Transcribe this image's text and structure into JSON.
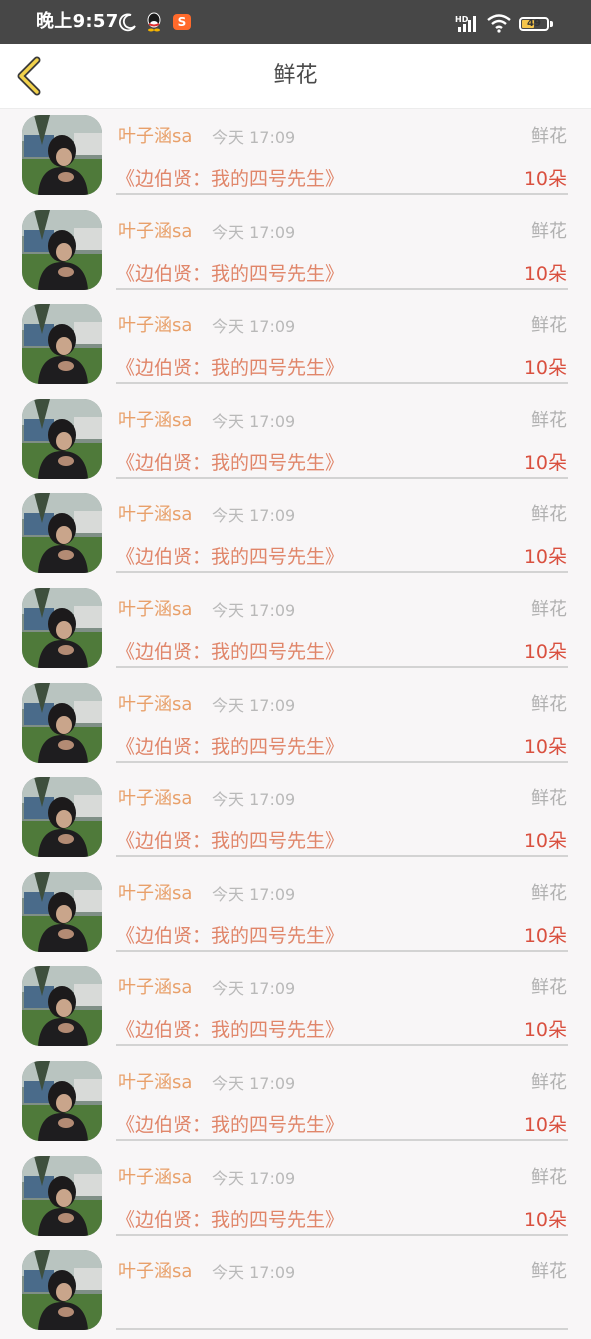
{
  "status_bar": {
    "time": "晚上9:57",
    "icons": [
      "moon-icon",
      "qq-icon",
      "sogou-icon",
      "hd-signal-icon",
      "wifi-icon",
      "battery-icon"
    ],
    "signal_label": "HD",
    "sogou_label": "S",
    "battery_percent": 49,
    "battery_text": "49"
  },
  "header": {
    "title": "鲜花",
    "back_icon": "chevron-left-icon",
    "accent_color": "#f2d24b"
  },
  "colors": {
    "user_name": "#e8a06a",
    "work_title": "#e0866a",
    "quantity": "#d9503f",
    "meta": "#b9b9b9"
  },
  "items": [
    {
      "user": "叶子涵sa",
      "time": "今天 17:09",
      "type": "鲜花",
      "work": "《边伯贤：我的四号先生》",
      "quantity": "10朵"
    },
    {
      "user": "叶子涵sa",
      "time": "今天 17:09",
      "type": "鲜花",
      "work": "《边伯贤：我的四号先生》",
      "quantity": "10朵"
    },
    {
      "user": "叶子涵sa",
      "time": "今天 17:09",
      "type": "鲜花",
      "work": "《边伯贤：我的四号先生》",
      "quantity": "10朵"
    },
    {
      "user": "叶子涵sa",
      "time": "今天 17:09",
      "type": "鲜花",
      "work": "《边伯贤：我的四号先生》",
      "quantity": "10朵"
    },
    {
      "user": "叶子涵sa",
      "time": "今天 17:09",
      "type": "鲜花",
      "work": "《边伯贤：我的四号先生》",
      "quantity": "10朵"
    },
    {
      "user": "叶子涵sa",
      "time": "今天 17:09",
      "type": "鲜花",
      "work": "《边伯贤：我的四号先生》",
      "quantity": "10朵"
    },
    {
      "user": "叶子涵sa",
      "time": "今天 17:09",
      "type": "鲜花",
      "work": "《边伯贤：我的四号先生》",
      "quantity": "10朵"
    },
    {
      "user": "叶子涵sa",
      "time": "今天 17:09",
      "type": "鲜花",
      "work": "《边伯贤：我的四号先生》",
      "quantity": "10朵"
    },
    {
      "user": "叶子涵sa",
      "time": "今天 17:09",
      "type": "鲜花",
      "work": "《边伯贤：我的四号先生》",
      "quantity": "10朵"
    },
    {
      "user": "叶子涵sa",
      "time": "今天 17:09",
      "type": "鲜花",
      "work": "《边伯贤：我的四号先生》",
      "quantity": "10朵"
    },
    {
      "user": "叶子涵sa",
      "time": "今天 17:09",
      "type": "鲜花",
      "work": "《边伯贤：我的四号先生》",
      "quantity": "10朵"
    },
    {
      "user": "叶子涵sa",
      "time": "今天 17:09",
      "type": "鲜花",
      "work": "《边伯贤：我的四号先生》",
      "quantity": "10朵"
    },
    {
      "user": "叶子涵sa",
      "time": "今天 17:09",
      "type": "鲜花",
      "work": "",
      "quantity": ""
    }
  ]
}
